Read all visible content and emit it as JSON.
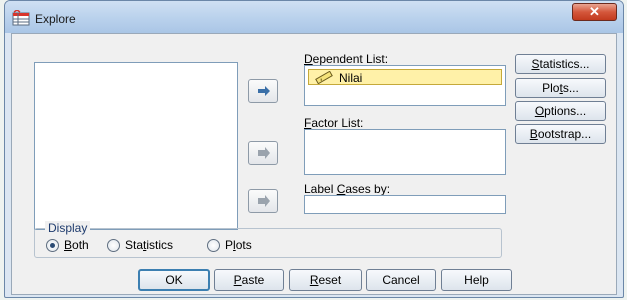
{
  "window": {
    "title": "Explore",
    "close_label": "✕"
  },
  "source_list": [],
  "dependent_list": {
    "label_pre": "",
    "label_key": "D",
    "label_post": "ependent List:",
    "items": [
      "Nilai"
    ]
  },
  "factor_list": {
    "label_pre": "",
    "label_key": "F",
    "label_post": "actor List:"
  },
  "label_cases": {
    "label_pre": "Label ",
    "label_key": "C",
    "label_post": "ases by:"
  },
  "side_buttons": {
    "statistics": {
      "pre": "",
      "key": "S",
      "post": "tatistics..."
    },
    "plots": {
      "pre": "Plo",
      "key": "t",
      "post": "s..."
    },
    "options": {
      "pre": "",
      "key": "O",
      "post": "ptions..."
    },
    "bootstrap": {
      "pre": "",
      "key": "B",
      "post": "ootstrap..."
    }
  },
  "display": {
    "legend": "Display",
    "selected": "Both",
    "both": {
      "pre": "",
      "key": "B",
      "post": "oth"
    },
    "statistics": {
      "pre": "Sta",
      "key": "t",
      "post": "istics"
    },
    "plots": {
      "pre": "P",
      "key": "l",
      "post": "ots"
    }
  },
  "bottom_buttons": {
    "ok": "OK",
    "paste": {
      "pre": "",
      "key": "P",
      "post": "aste"
    },
    "reset": {
      "pre": "",
      "key": "R",
      "post": "eset"
    },
    "cancel": "Cancel",
    "help": "Help"
  },
  "colors": {
    "selected_item": "#fff1a8",
    "arrow_active": "#3a6fa8",
    "arrow_inactive": "#9aa3ad",
    "close_button": "#d4573c"
  },
  "icons": {
    "title": "explore-table-icon",
    "variable": "ruler-scale-icon"
  }
}
